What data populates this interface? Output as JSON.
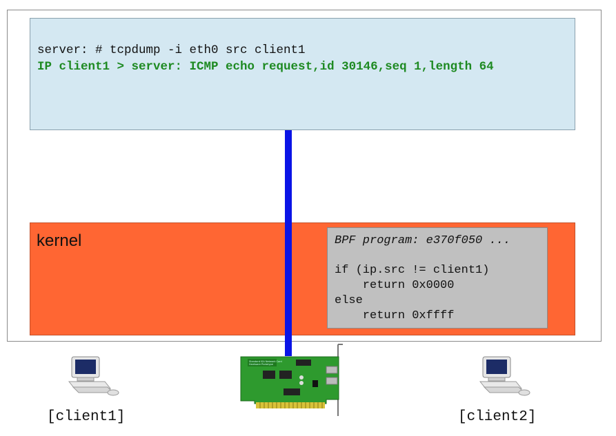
{
  "userspace": {
    "command": "server: # tcpdump -i eth0 src client1",
    "output": "IP client1 > server: ICMP echo request,id 30146,seq 1,length 64"
  },
  "kernel": {
    "label": "kernel",
    "bpf": {
      "title": "BPF program: e370f050 ...",
      "lines": [
        "if (ip.src != client1)",
        "    return 0x0000",
        "else",
        "    return 0xffff"
      ]
    }
  },
  "clients": [
    {
      "label": "[client1]"
    },
    {
      "label": "[client2]"
    }
  ],
  "nic": {
    "board_text": "Standard ISA Network Card",
    "board_text2": "Hardware Prototype"
  },
  "colors": {
    "userspace_bg": "#d4e8f2",
    "kernel_bg": "#ff6633",
    "bpf_bg": "#c0c0c0",
    "wire": "#0a14e6",
    "output_text": "#1e8a22",
    "nic_board": "#2e9a2e"
  }
}
